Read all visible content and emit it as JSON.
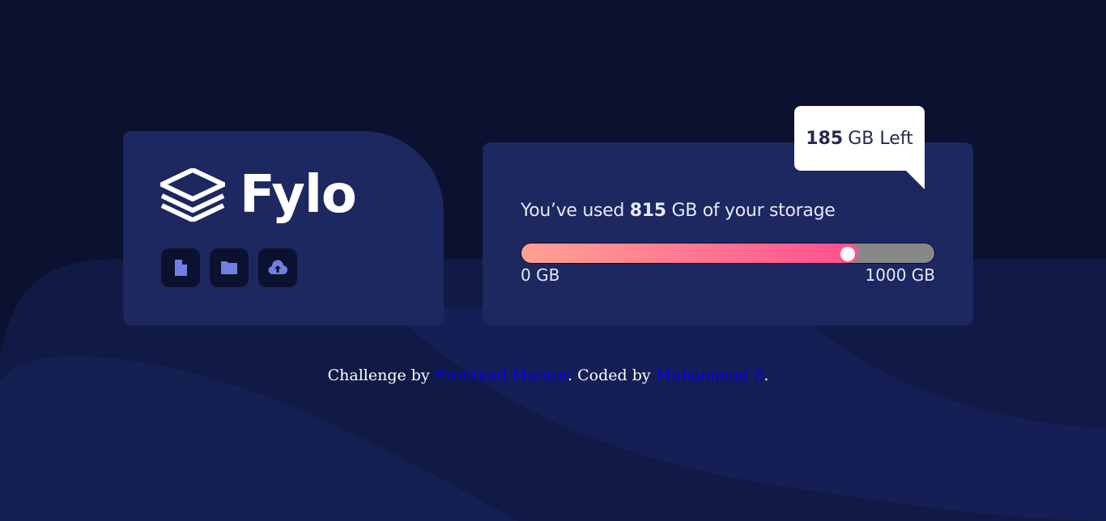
{
  "brand": {
    "name": "Fylo"
  },
  "toolbar": {
    "icons": [
      "document-icon",
      "folder-icon",
      "upload-icon"
    ]
  },
  "storage": {
    "used_prefix": "You’ve used",
    "used_value": "815",
    "used_suffix": "GB of your storage",
    "min_label": "0 GB",
    "max_label": "1000 GB",
    "used_fraction": 0.815,
    "left_value": "185",
    "left_suffix": "GB Left"
  },
  "attribution": {
    "prefix": "Challenge by",
    "link1": "Frontend Mentor",
    "middle": ". Coded by",
    "link2": "Muhammad Z",
    "suffix": "."
  },
  "colors": {
    "page_bg": "#0c1130",
    "card_bg": "#1d2760",
    "accent_start": "#ffa192",
    "accent_end": "#ff4f8f",
    "icon_color": "#7180e0"
  }
}
